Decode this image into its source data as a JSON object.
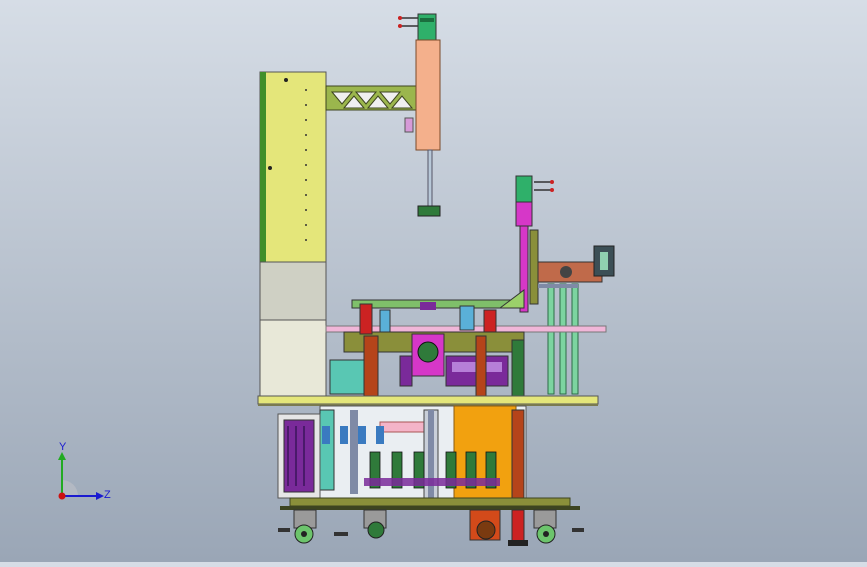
{
  "viewport": {
    "background_top": "#d6dde6",
    "background_bottom": "#9aa6b6"
  },
  "triad": {
    "y_label": "Y",
    "z_label": "Z",
    "y_color": "#22aa22",
    "z_color": "#1a1ad0",
    "origin_color": "#cc1111"
  },
  "palette": {
    "frame_yellow": "#e4e67a",
    "frame_green": "#7bc043",
    "panel_grey": "#d2d2c8",
    "salmon": "#f4b08c",
    "magenta": "#d637c8",
    "purple": "#7a2a9a",
    "orange": "#f2a10f",
    "teal": "#59c7b3",
    "olive": "#8a8f3a",
    "dark_olive": "#3d4420",
    "red_brown": "#b5441a",
    "steel": "#7f8aa6"
  }
}
